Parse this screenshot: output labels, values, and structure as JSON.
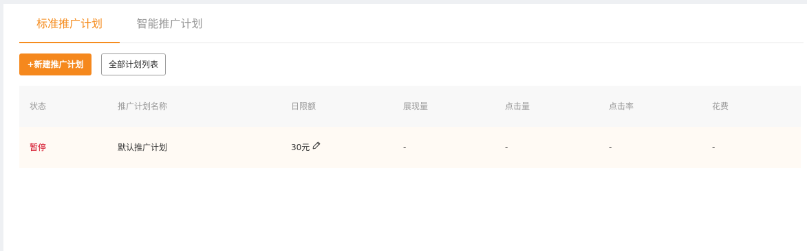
{
  "tabs": [
    {
      "label": "标准推广计划",
      "active": true
    },
    {
      "label": "智能推广计划",
      "active": false
    }
  ],
  "toolbar": {
    "new_plan_label": "+新建推广计划",
    "all_plans_label": "全部计划列表"
  },
  "table": {
    "headers": [
      "状态",
      "推广计划名称",
      "日限额",
      "展现量",
      "点击量",
      "点击率",
      "花费"
    ],
    "rows": [
      {
        "status": "暂停",
        "name": "默认推广计划",
        "daily_limit": "30元",
        "impressions": "-",
        "clicks": "-",
        "ctr": "-",
        "cost": "-"
      }
    ]
  },
  "colors": {
    "accent": "#f58c1e",
    "status_paused": "#d0021b"
  },
  "icons": {
    "edit": "pencil-icon"
  }
}
